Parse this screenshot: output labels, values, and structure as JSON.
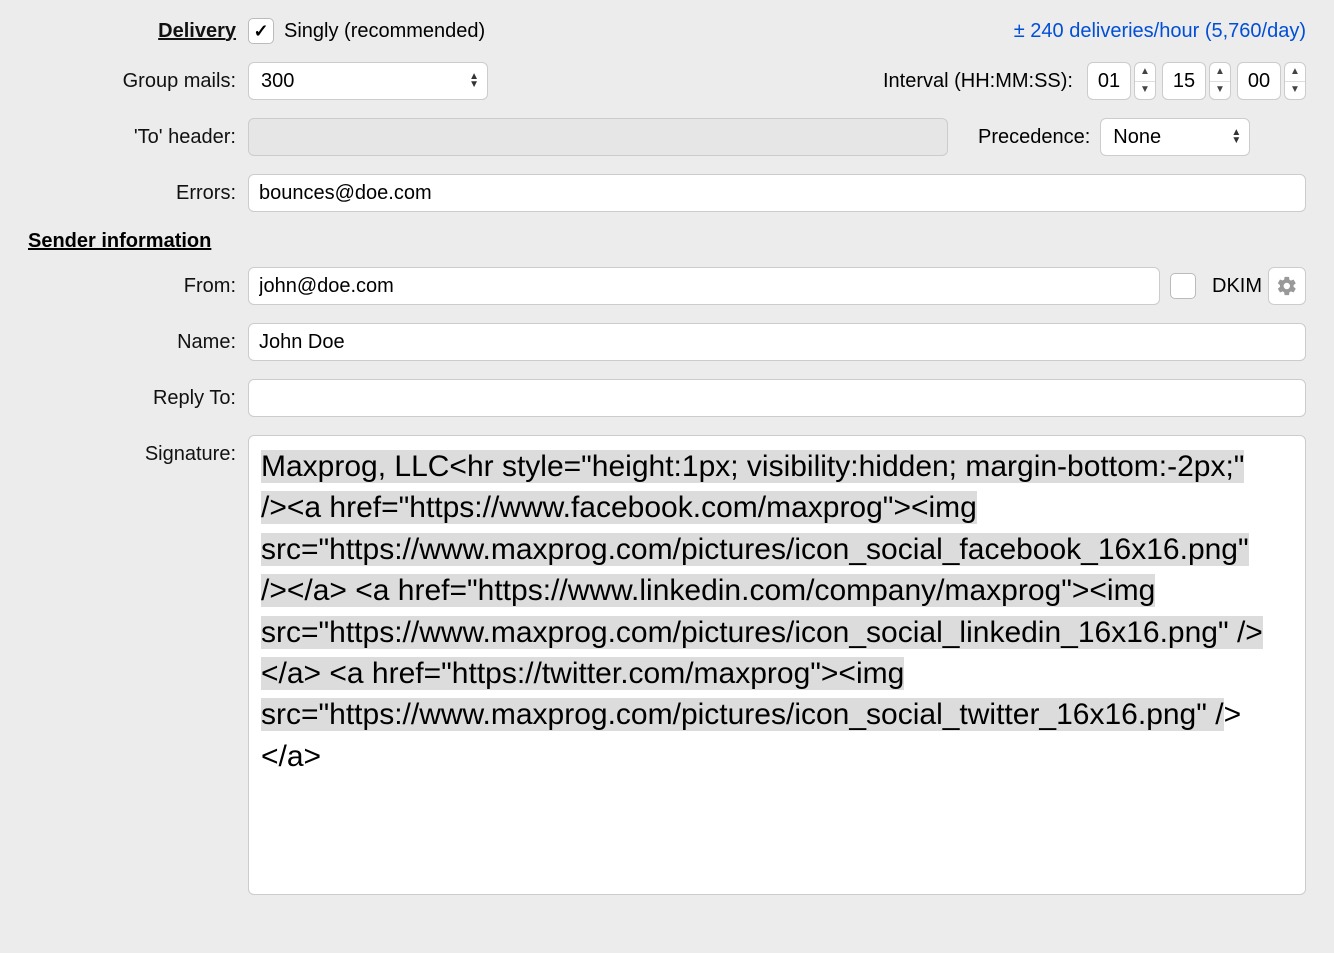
{
  "delivery": {
    "heading": "Delivery",
    "singly_checked": true,
    "singly_label": "Singly (recommended)",
    "rate_text": "± 240 deliveries/hour (5,760/day)",
    "group_mails_label": "Group mails:",
    "group_mails_value": "300",
    "interval_label": "Interval (HH:MM:SS):",
    "interval_hh": "01",
    "interval_mm": "15",
    "interval_ss": "00",
    "to_header_label": "'To' header:",
    "to_header_value": "",
    "precedence_label": "Precedence:",
    "precedence_value": "None",
    "errors_label": "Errors:",
    "errors_value": "bounces@doe.com"
  },
  "sender": {
    "heading": "Sender information",
    "from_label": "From:",
    "from_value": "john@doe.com",
    "dkim_checked": false,
    "dkim_label": "DKIM",
    "name_label": "Name:",
    "name_value": "John Doe",
    "replyto_label": "Reply To:",
    "replyto_value": "",
    "signature_label": "Signature:",
    "signature_value": "Maxprog, LLC<hr style=\"height:1px; visibility:hidden; margin-bottom:-2px;\" /><a href=\"https://www.facebook.com/maxprog\"><img src=\"https://www.maxprog.com/pictures/icon_social_facebook_16x16.png\"  /></a> <a href=\"https://www.linkedin.com/company/maxprog\"><img src=\"https://www.maxprog.com/pictures/icon_social_linkedin_16x16.png\" /></a> <a href=\"https://twitter.com/maxprog\"><img src=\"https://www.maxprog.com/pictures/icon_social_twitter_16x16.png\" /",
    "signature_tail": "></a>"
  }
}
